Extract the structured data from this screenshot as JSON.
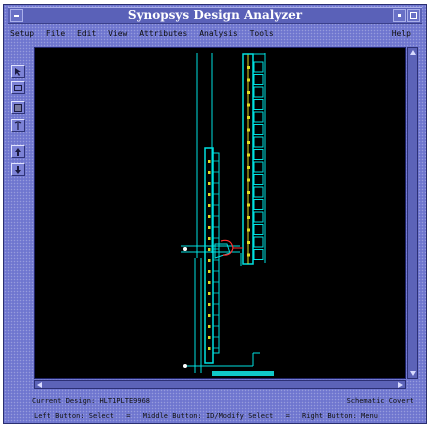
{
  "window": {
    "title": "Synopsys Design Analyzer"
  },
  "menu": {
    "items": [
      "Setup",
      "File",
      "Edit",
      "View",
      "Attributes",
      "Analysis",
      "Tools"
    ],
    "help": "Help"
  },
  "toolbar": {
    "icons": [
      "select-pointer-icon",
      "box-select-icon",
      "schematic-icon",
      "symbol-icon",
      "hierarchy-up-icon",
      "hierarchy-down-icon"
    ]
  },
  "canvas": {
    "colors": {
      "background": "#000000",
      "net": "#00e0e0",
      "bus": "#dddd22",
      "highlight": "#ff3030",
      "port": "#ffffff"
    }
  },
  "status": {
    "design_label": "Current Design:",
    "design_name": "HLT1PLTE9968",
    "view_mode": "Schematic Covert",
    "hint_left": "Left Button: Select",
    "hint_sep1": "=",
    "hint_middle": "Middle Button: ID/Modify Select",
    "hint_sep2": "=",
    "hint_right": "Right Button: Menu"
  }
}
